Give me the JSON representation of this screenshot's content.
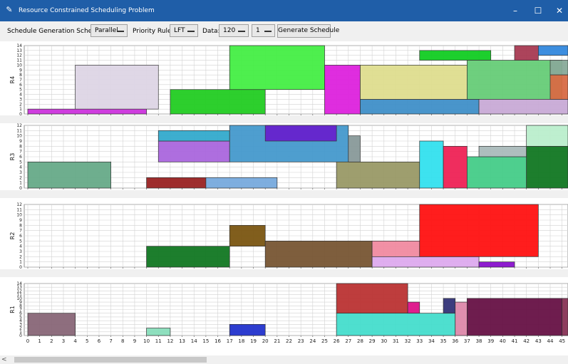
{
  "window": {
    "title": "Resource Constrained Scheduling Problem",
    "controls": {
      "minimize": "–",
      "maximize": "☐",
      "close": "✕"
    }
  },
  "toolbar": {
    "sgs_label": "Schedule Generation Scheme:",
    "sgs_value": "Parallel",
    "priority_label": "Priority Rule:",
    "priority_value": "LFT",
    "data_label": "Data:",
    "data_value": "120",
    "instance_value": "1",
    "generate_label": "Generate Schedule"
  },
  "scrollbar": {
    "left_arrow": "<"
  },
  "chart_data": {
    "type": "gantt",
    "x_ticks": [
      0,
      1,
      2,
      3,
      4,
      5,
      6,
      7,
      8,
      9,
      10,
      11,
      12,
      13,
      14,
      15,
      16,
      17,
      18,
      19,
      20,
      21,
      22,
      23,
      24,
      25,
      26,
      27,
      28,
      29,
      30,
      31,
      32,
      33,
      34,
      35,
      36,
      37,
      38,
      39,
      40,
      41,
      42,
      43,
      44,
      45
    ],
    "xlim": [
      -0.3,
      45.5
    ],
    "panels": [
      {
        "resource": "R4",
        "ylim": [
          0,
          14
        ],
        "y_ticks": [
          0,
          1,
          2,
          3,
          4,
          5,
          6,
          7,
          8,
          9,
          10,
          11,
          12,
          13,
          14
        ],
        "tasks": [
          {
            "start": 0,
            "end": 10,
            "bottom": 0,
            "top": 1,
            "color": "#cc33dd"
          },
          {
            "start": 4,
            "end": 11,
            "bottom": 1,
            "top": 10,
            "color": "#ddd5e5"
          },
          {
            "start": 12,
            "end": 20,
            "bottom": 0,
            "top": 5,
            "color": "#22cc22"
          },
          {
            "start": 17,
            "end": 25,
            "bottom": 5,
            "top": 14,
            "color": "#44ee44"
          },
          {
            "start": 25,
            "end": 28,
            "bottom": 0,
            "top": 10,
            "color": "#dd22dd"
          },
          {
            "start": 28,
            "end": 38,
            "bottom": 0,
            "top": 3,
            "color": "#3f8fc8"
          },
          {
            "start": 28,
            "end": 37,
            "bottom": 3,
            "top": 10,
            "color": "#dedd8e"
          },
          {
            "start": 33,
            "end": 39,
            "bottom": 11,
            "top": 13,
            "color": "#11cc22"
          },
          {
            "start": 37,
            "end": 45,
            "bottom": 3,
            "top": 11,
            "color": "#66cc77"
          },
          {
            "start": 38,
            "end": 45.5,
            "bottom": 0,
            "top": 3,
            "color": "#c8aad6"
          },
          {
            "start": 41,
            "end": 43,
            "bottom": 11,
            "top": 14,
            "color": "#a83a52"
          },
          {
            "start": 43,
            "end": 45.5,
            "bottom": 12,
            "top": 14,
            "color": "#3388dd"
          },
          {
            "start": 44,
            "end": 45.5,
            "bottom": 8,
            "top": 11,
            "color": "#88aa99"
          },
          {
            "start": 44,
            "end": 45.5,
            "bottom": 3,
            "top": 8,
            "color": "#d86a44"
          }
        ]
      },
      {
        "resource": "R3",
        "ylim": [
          0,
          12
        ],
        "y_ticks": [
          0,
          1,
          2,
          3,
          4,
          5,
          6,
          7,
          8,
          9,
          10,
          11,
          12
        ],
        "tasks": [
          {
            "start": 0,
            "end": 7,
            "bottom": 0,
            "top": 5,
            "color": "#66aa88"
          },
          {
            "start": 10,
            "end": 15,
            "bottom": 0,
            "top": 2,
            "color": "#992222"
          },
          {
            "start": 11,
            "end": 17,
            "bottom": 5,
            "top": 9,
            "color": "#aa66dd"
          },
          {
            "start": 11,
            "end": 17,
            "bottom": 9,
            "top": 11,
            "color": "#33aacc"
          },
          {
            "start": 15,
            "end": 21,
            "bottom": 0,
            "top": 2,
            "color": "#77aadd"
          },
          {
            "start": 17,
            "end": 27,
            "bottom": 5,
            "top": 12,
            "color": "#4499cc"
          },
          {
            "start": 20,
            "end": 26,
            "bottom": 9,
            "top": 12,
            "color": "#6622cc"
          },
          {
            "start": 26,
            "end": 33,
            "bottom": 0,
            "top": 5,
            "color": "#999966"
          },
          {
            "start": 27,
            "end": 28,
            "bottom": 5,
            "top": 10,
            "color": "#889999"
          },
          {
            "start": 33,
            "end": 35,
            "bottom": 0,
            "top": 9,
            "color": "#33e0ee"
          },
          {
            "start": 35,
            "end": 37,
            "bottom": 0,
            "top": 8,
            "color": "#ee2255"
          },
          {
            "start": 37,
            "end": 42,
            "bottom": 0,
            "top": 6,
            "color": "#44cc88"
          },
          {
            "start": 38,
            "end": 42,
            "bottom": 6,
            "top": 8,
            "color": "#aabbbb"
          },
          {
            "start": 42,
            "end": 45.5,
            "bottom": 0,
            "top": 8,
            "color": "#117722"
          },
          {
            "start": 42,
            "end": 45.5,
            "bottom": 8,
            "top": 12,
            "color": "#bbeecc"
          }
        ]
      },
      {
        "resource": "R2",
        "ylim": [
          0,
          12
        ],
        "y_ticks": [
          0,
          1,
          2,
          3,
          4,
          5,
          6,
          7,
          8,
          9,
          10,
          11,
          12
        ],
        "tasks": [
          {
            "start": 10,
            "end": 17,
            "bottom": 0,
            "top": 4,
            "color": "#117722"
          },
          {
            "start": 17,
            "end": 20,
            "bottom": 4,
            "top": 8,
            "color": "#7a5511"
          },
          {
            "start": 20,
            "end": 29,
            "bottom": 0,
            "top": 5,
            "color": "#775533"
          },
          {
            "start": 29,
            "end": 33,
            "bottom": 2,
            "top": 5,
            "color": "#f08aa0"
          },
          {
            "start": 29,
            "end": 38,
            "bottom": 0,
            "top": 2,
            "color": "#ddaaee"
          },
          {
            "start": 33,
            "end": 43,
            "bottom": 2,
            "top": 12,
            "color": "#ff1111"
          },
          {
            "start": 38,
            "end": 41,
            "bottom": 0,
            "top": 1,
            "color": "#8811cc"
          }
        ]
      },
      {
        "resource": "R1",
        "ylim": [
          0,
          14
        ],
        "y_ticks": [
          0,
          1,
          2,
          3,
          4,
          5,
          6,
          7,
          8,
          9,
          10,
          11,
          12,
          13,
          14
        ],
        "tasks": [
          {
            "start": 0,
            "end": 4,
            "bottom": 0,
            "top": 6,
            "color": "#886677"
          },
          {
            "start": 10,
            "end": 12,
            "bottom": 0,
            "top": 2,
            "color": "#88ddbb"
          },
          {
            "start": 17,
            "end": 20,
            "bottom": 0,
            "top": 3,
            "color": "#2233cc"
          },
          {
            "start": 26,
            "end": 32,
            "bottom": 6,
            "top": 14,
            "color": "#bb3333"
          },
          {
            "start": 26,
            "end": 36,
            "bottom": 0,
            "top": 6,
            "color": "#44ddcc"
          },
          {
            "start": 32,
            "end": 33,
            "bottom": 6,
            "top": 9,
            "color": "#dd1188"
          },
          {
            "start": 35,
            "end": 36,
            "bottom": 6,
            "top": 10,
            "color": "#333377"
          },
          {
            "start": 36,
            "end": 37,
            "bottom": 0,
            "top": 9,
            "color": "#dd88aa"
          },
          {
            "start": 37,
            "end": 45,
            "bottom": 0,
            "top": 10,
            "color": "#661144"
          },
          {
            "start": 45,
            "end": 45.5,
            "bottom": 0,
            "top": 10,
            "color": "#883355"
          }
        ]
      }
    ]
  }
}
